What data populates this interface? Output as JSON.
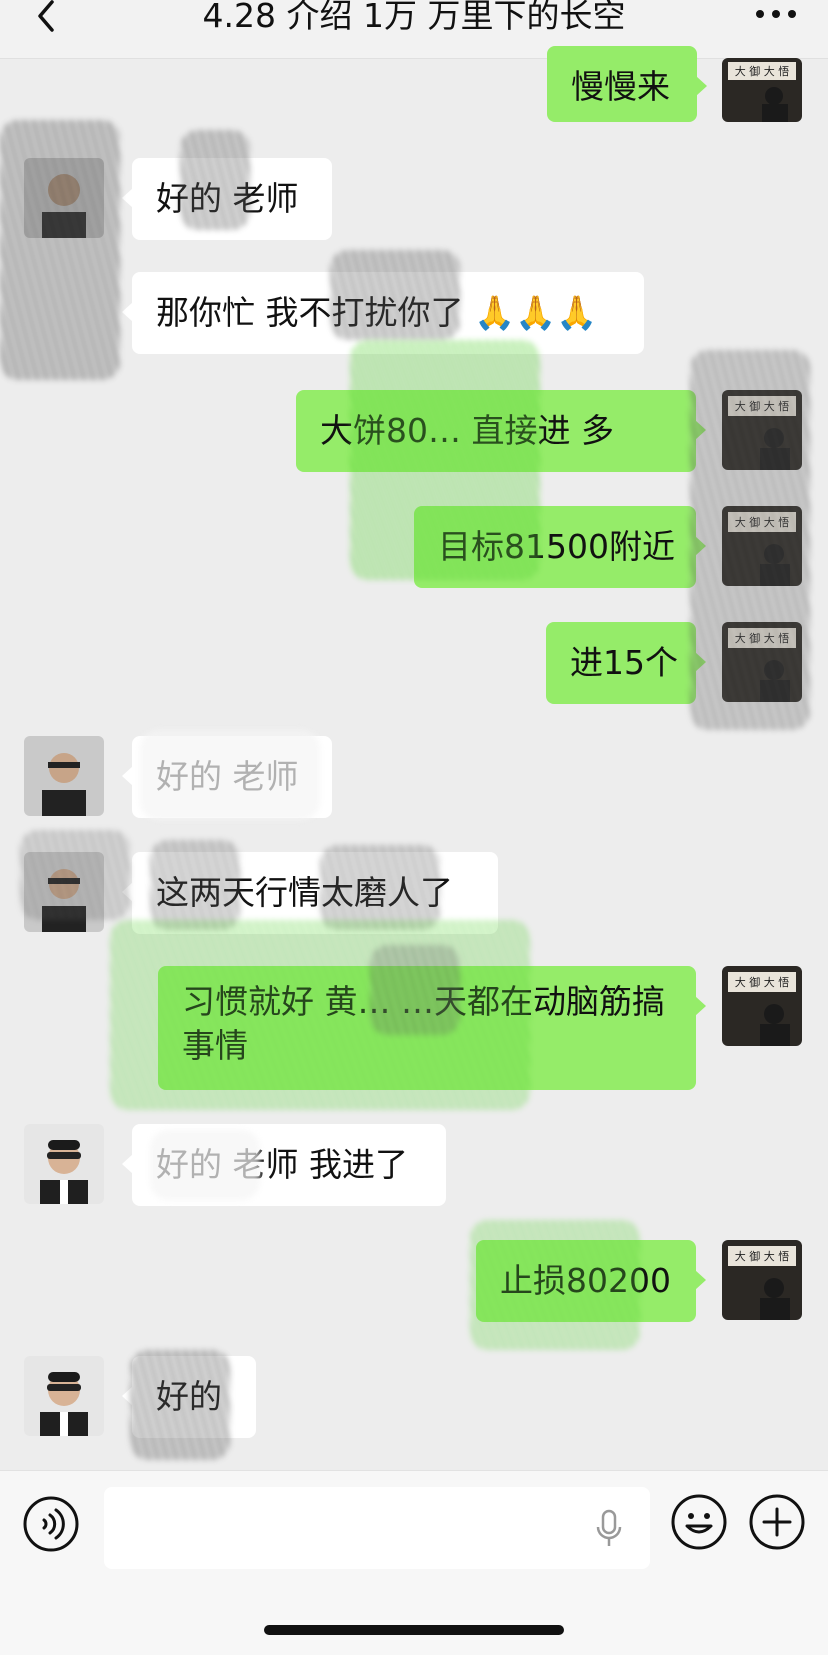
{
  "header": {
    "title": "4.28 介绍 1万 万里下的长空",
    "back_icon": "chevron-left-icon",
    "more_icon": "more-dots-icon"
  },
  "messages": [
    {
      "side": "out",
      "text": "慢慢来"
    },
    {
      "side": "in",
      "text": "好的 老师"
    },
    {
      "side": "in",
      "text": "那你忙 我不打扰你了 🙏🙏🙏"
    },
    {
      "side": "out",
      "text": "大饼80…  直接进 多"
    },
    {
      "side": "out",
      "text": "目标81500附近"
    },
    {
      "side": "out",
      "text": "进15个"
    },
    {
      "side": "in",
      "text": "好的 老师"
    },
    {
      "side": "in",
      "text": "这两天行情太磨人了"
    },
    {
      "side": "out",
      "text": "习惯就好 黄…  …天都在动脑筋搞事情"
    },
    {
      "side": "in",
      "text": "好的 老师 我进了"
    },
    {
      "side": "out",
      "text": "止损80200"
    },
    {
      "side": "in",
      "text": "好的"
    }
  ],
  "input_bar": {
    "voice_icon": "voice-input-icon",
    "mic_icon": "microphone-icon",
    "emoji_icon": "emoji-icon",
    "plus_icon": "plus-icon",
    "placeholder": ""
  },
  "colors": {
    "outgoing_bubble": "#95ec69",
    "incoming_bubble": "#ffffff",
    "background": "#ededed"
  }
}
